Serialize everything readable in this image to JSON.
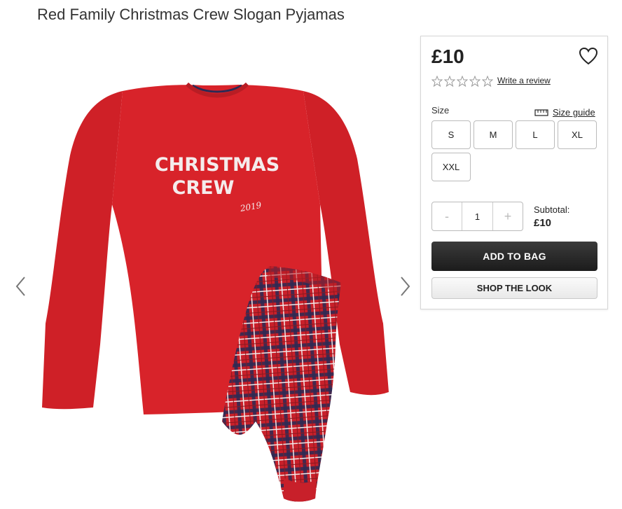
{
  "product": {
    "title": "Red Family Christmas Crew Slogan Pyjamas",
    "image": {
      "alt": "Red Family Christmas Crew Slogan Pyjamas",
      "slogan_line1": "CHRISTMAS",
      "slogan_line2": "CREW",
      "slogan_year": "2019"
    }
  },
  "gallery": {
    "prev_icon": "chevron-left-icon",
    "next_icon": "chevron-right-icon"
  },
  "panel": {
    "price": "£10",
    "wishlist_icon": "heart-icon",
    "rating": {
      "stars_filled": 0,
      "stars_total": 5,
      "write_review": "Write a review"
    },
    "size_label": "Size",
    "size_guide": {
      "label": "Size guide",
      "icon": "ruler-icon"
    },
    "sizes": [
      "S",
      "M",
      "L",
      "XL",
      "XXL"
    ],
    "quantity": {
      "minus": "-",
      "value": "1",
      "plus": "+"
    },
    "subtotal_label": "Subtotal:",
    "subtotal_value": "£10",
    "add_to_bag": "ADD TO BAG",
    "shop_the_look": "SHOP THE LOOK"
  },
  "colors": {
    "pyjama_red": "#d8232a",
    "check_navy": "#2b2a55",
    "button_dark": "#222222"
  }
}
